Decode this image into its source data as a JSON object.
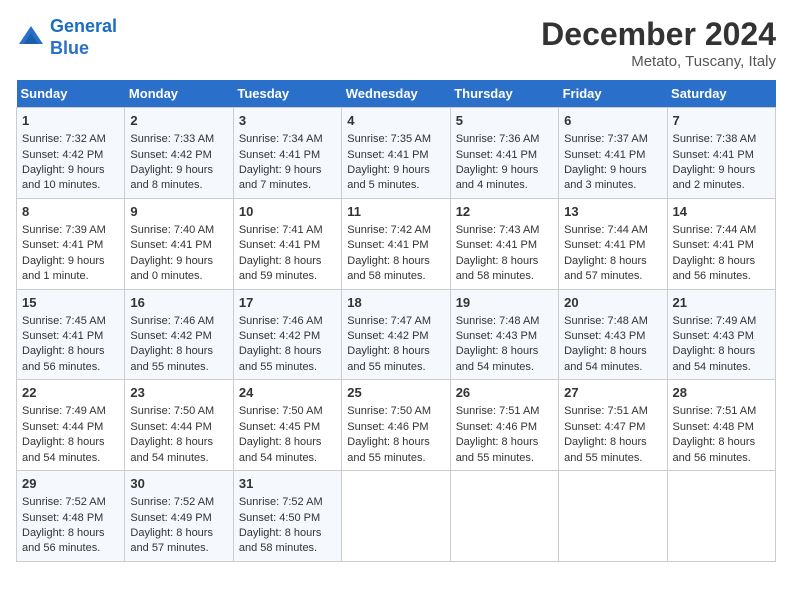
{
  "header": {
    "logo_line1": "General",
    "logo_line2": "Blue",
    "month": "December 2024",
    "location": "Metato, Tuscany, Italy"
  },
  "days_of_week": [
    "Sunday",
    "Monday",
    "Tuesday",
    "Wednesday",
    "Thursday",
    "Friday",
    "Saturday"
  ],
  "weeks": [
    [
      {
        "day": 1,
        "sunrise": "7:32 AM",
        "sunset": "4:42 PM",
        "daylight": "9 hours and 10 minutes."
      },
      {
        "day": 2,
        "sunrise": "7:33 AM",
        "sunset": "4:42 PM",
        "daylight": "9 hours and 8 minutes."
      },
      {
        "day": 3,
        "sunrise": "7:34 AM",
        "sunset": "4:41 PM",
        "daylight": "9 hours and 7 minutes."
      },
      {
        "day": 4,
        "sunrise": "7:35 AM",
        "sunset": "4:41 PM",
        "daylight": "9 hours and 5 minutes."
      },
      {
        "day": 5,
        "sunrise": "7:36 AM",
        "sunset": "4:41 PM",
        "daylight": "9 hours and 4 minutes."
      },
      {
        "day": 6,
        "sunrise": "7:37 AM",
        "sunset": "4:41 PM",
        "daylight": "9 hours and 3 minutes."
      },
      {
        "day": 7,
        "sunrise": "7:38 AM",
        "sunset": "4:41 PM",
        "daylight": "9 hours and 2 minutes."
      }
    ],
    [
      {
        "day": 8,
        "sunrise": "7:39 AM",
        "sunset": "4:41 PM",
        "daylight": "9 hours and 1 minute."
      },
      {
        "day": 9,
        "sunrise": "7:40 AM",
        "sunset": "4:41 PM",
        "daylight": "9 hours and 0 minutes."
      },
      {
        "day": 10,
        "sunrise": "7:41 AM",
        "sunset": "4:41 PM",
        "daylight": "8 hours and 59 minutes."
      },
      {
        "day": 11,
        "sunrise": "7:42 AM",
        "sunset": "4:41 PM",
        "daylight": "8 hours and 58 minutes."
      },
      {
        "day": 12,
        "sunrise": "7:43 AM",
        "sunset": "4:41 PM",
        "daylight": "8 hours and 58 minutes."
      },
      {
        "day": 13,
        "sunrise": "7:44 AM",
        "sunset": "4:41 PM",
        "daylight": "8 hours and 57 minutes."
      },
      {
        "day": 14,
        "sunrise": "7:44 AM",
        "sunset": "4:41 PM",
        "daylight": "8 hours and 56 minutes."
      }
    ],
    [
      {
        "day": 15,
        "sunrise": "7:45 AM",
        "sunset": "4:41 PM",
        "daylight": "8 hours and 56 minutes."
      },
      {
        "day": 16,
        "sunrise": "7:46 AM",
        "sunset": "4:42 PM",
        "daylight": "8 hours and 55 minutes."
      },
      {
        "day": 17,
        "sunrise": "7:46 AM",
        "sunset": "4:42 PM",
        "daylight": "8 hours and 55 minutes."
      },
      {
        "day": 18,
        "sunrise": "7:47 AM",
        "sunset": "4:42 PM",
        "daylight": "8 hours and 55 minutes."
      },
      {
        "day": 19,
        "sunrise": "7:48 AM",
        "sunset": "4:43 PM",
        "daylight": "8 hours and 54 minutes."
      },
      {
        "day": 20,
        "sunrise": "7:48 AM",
        "sunset": "4:43 PM",
        "daylight": "8 hours and 54 minutes."
      },
      {
        "day": 21,
        "sunrise": "7:49 AM",
        "sunset": "4:43 PM",
        "daylight": "8 hours and 54 minutes."
      }
    ],
    [
      {
        "day": 22,
        "sunrise": "7:49 AM",
        "sunset": "4:44 PM",
        "daylight": "8 hours and 54 minutes."
      },
      {
        "day": 23,
        "sunrise": "7:50 AM",
        "sunset": "4:44 PM",
        "daylight": "8 hours and 54 minutes."
      },
      {
        "day": 24,
        "sunrise": "7:50 AM",
        "sunset": "4:45 PM",
        "daylight": "8 hours and 54 minutes."
      },
      {
        "day": 25,
        "sunrise": "7:50 AM",
        "sunset": "4:46 PM",
        "daylight": "8 hours and 55 minutes."
      },
      {
        "day": 26,
        "sunrise": "7:51 AM",
        "sunset": "4:46 PM",
        "daylight": "8 hours and 55 minutes."
      },
      {
        "day": 27,
        "sunrise": "7:51 AM",
        "sunset": "4:47 PM",
        "daylight": "8 hours and 55 minutes."
      },
      {
        "day": 28,
        "sunrise": "7:51 AM",
        "sunset": "4:48 PM",
        "daylight": "8 hours and 56 minutes."
      }
    ],
    [
      {
        "day": 29,
        "sunrise": "7:52 AM",
        "sunset": "4:48 PM",
        "daylight": "8 hours and 56 minutes."
      },
      {
        "day": 30,
        "sunrise": "7:52 AM",
        "sunset": "4:49 PM",
        "daylight": "8 hours and 57 minutes."
      },
      {
        "day": 31,
        "sunrise": "7:52 AM",
        "sunset": "4:50 PM",
        "daylight": "8 hours and 58 minutes."
      },
      null,
      null,
      null,
      null
    ]
  ]
}
